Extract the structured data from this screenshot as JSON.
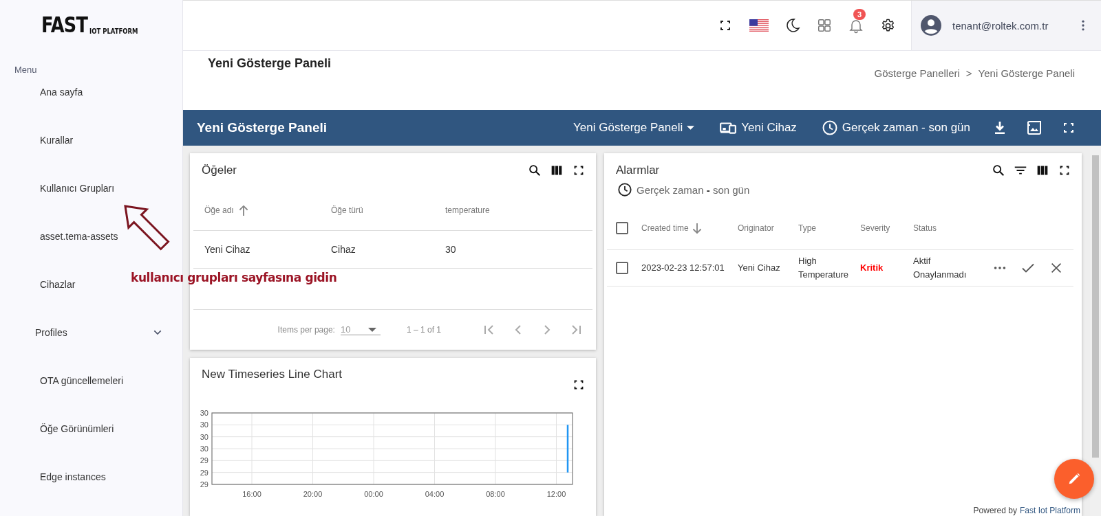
{
  "logo": {
    "main": "FAST",
    "sub": "IOT PLATFORM"
  },
  "sidebar": {
    "heading": "Menu",
    "items": [
      {
        "label": "Ana sayfa",
        "kind": "link"
      },
      {
        "label": "Kurallar",
        "kind": "link"
      },
      {
        "label": "Kullanıcı Grupları",
        "kind": "link"
      },
      {
        "label": "asset.tema-assets",
        "kind": "link"
      },
      {
        "label": "Cihazlar",
        "kind": "link"
      },
      {
        "label": "Profiles",
        "kind": "group",
        "expanded": false
      },
      {
        "label": "OTA güncellemeleri",
        "kind": "link"
      },
      {
        "label": "Öğe Görünümleri",
        "kind": "link"
      },
      {
        "label": "Edge instances",
        "kind": "link"
      }
    ]
  },
  "header": {
    "notification_count": "3",
    "user": "tenant@roltek.com.tr"
  },
  "page": {
    "title": "Yeni Gösterge Paneli",
    "breadcrumb": [
      "Gösterge Panelleri",
      "Yeni Gösterge Paneli"
    ],
    "breadcrumb_separator": ">"
  },
  "dashboard_bar": {
    "title": "Yeni Gösterge Paneli",
    "dashboard_select": "Yeni Gösterge Paneli",
    "entity": "Yeni Cihaz",
    "timewindow": "Gerçek zaman - son gün"
  },
  "entities_widget": {
    "title": "Öğeler",
    "columns": [
      {
        "label": "Öğe adı",
        "sorted": true,
        "ascending": true
      },
      {
        "label": "Öğe türü",
        "sorted": false
      },
      {
        "label": "temperature",
        "sorted": false
      }
    ],
    "rows": [
      [
        "Yeni Cihaz",
        "Cihaz",
        "30"
      ]
    ],
    "paginator": {
      "label": "Items per page:",
      "page_size": "10",
      "range": "1 – 1 of 1"
    }
  },
  "alarms_widget": {
    "title": "Alarmlar",
    "timewindow": "Gerçek zaman **-** son gün",
    "all_checked": false,
    "columns": [
      {
        "label": "Created time",
        "sorted": true,
        "ascending": false
      },
      {
        "label": "Originator",
        "sorted": false
      },
      {
        "label": "Type",
        "sorted": false
      },
      {
        "label": "Severity",
        "sorted": false
      },
      {
        "label": "Status",
        "sorted": false
      }
    ],
    "rows": [
      {
        "checked": false,
        "created_time": "2023-02-23 12:57:01",
        "originator": "Yeni Cihaz",
        "type": "High Temperature",
        "severity": {
          "label": "Kritik",
          "kind": "critical"
        },
        "status": "Aktif Onaylanmadı"
      }
    ]
  },
  "chart_widget": {
    "title": "New Timeseries Line Chart",
    "x_tick_labels": [
      "16:00",
      "20:00",
      "00:00",
      "04:00",
      "08:00",
      "12:00"
    ],
    "y_tick_labels": [
      "30",
      "30",
      "30",
      "30",
      "29",
      "29",
      "29"
    ]
  },
  "annotation": {
    "text": "kullanıcı grupları sayfasına gidin"
  },
  "footer": {
    "powered_by": "Powered by",
    "brand": "Fast Iot Platform"
  }
}
